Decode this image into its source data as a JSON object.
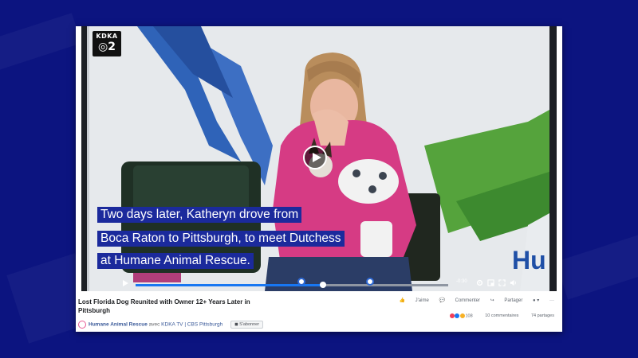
{
  "channel_logo": {
    "top": "KDKA",
    "bottom": "2"
  },
  "captions": [
    "Two days later, Katheryn drove from",
    "Boca Raton to Pittsburgh, to meet Dutchess",
    "at Humane Animal Rescue."
  ],
  "wall_text": "Hu",
  "player": {
    "time_remaining": "-0:30",
    "progress_fraction": 0.6,
    "markers": [
      0.53,
      0.75
    ]
  },
  "post": {
    "title": "Lost Florida Dog Reunited with Owner 12+ Years Later in Pittsburgh",
    "page_name": "Humane Animal Rescue",
    "with_text": "avec",
    "partners": "KDKA TV | CBS Pittsburgh",
    "subscribe_label": "S'abonner",
    "actions": {
      "like": "J'aime",
      "comment": "Commenter",
      "share": "Partager"
    },
    "stats": {
      "reactions": "108",
      "comments": "10 commentaires",
      "shares": "74 partages"
    }
  },
  "colors": {
    "page_background": "#0c1480",
    "caption_bg": "#1b2a9c",
    "progress": "#1877f2",
    "page_link": "#385898"
  },
  "icons": [
    "play-icon",
    "settings-icon",
    "fullscreen-icon",
    "volume-icon",
    "like-icon",
    "comment-icon",
    "share-icon"
  ]
}
